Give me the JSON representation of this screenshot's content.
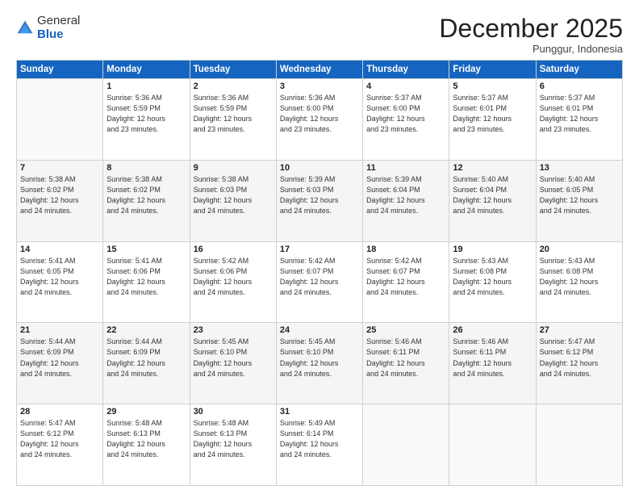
{
  "logo": {
    "general": "General",
    "blue": "Blue"
  },
  "header": {
    "month": "December 2025",
    "location": "Punggur, Indonesia"
  },
  "weekdays": [
    "Sunday",
    "Monday",
    "Tuesday",
    "Wednesday",
    "Thursday",
    "Friday",
    "Saturday"
  ],
  "weeks": [
    [
      {
        "day": "",
        "info": ""
      },
      {
        "day": "1",
        "info": "Sunrise: 5:36 AM\nSunset: 5:59 PM\nDaylight: 12 hours\nand 23 minutes."
      },
      {
        "day": "2",
        "info": "Sunrise: 5:36 AM\nSunset: 5:59 PM\nDaylight: 12 hours\nand 23 minutes."
      },
      {
        "day": "3",
        "info": "Sunrise: 5:36 AM\nSunset: 6:00 PM\nDaylight: 12 hours\nand 23 minutes."
      },
      {
        "day": "4",
        "info": "Sunrise: 5:37 AM\nSunset: 6:00 PM\nDaylight: 12 hours\nand 23 minutes."
      },
      {
        "day": "5",
        "info": "Sunrise: 5:37 AM\nSunset: 6:01 PM\nDaylight: 12 hours\nand 23 minutes."
      },
      {
        "day": "6",
        "info": "Sunrise: 5:37 AM\nSunset: 6:01 PM\nDaylight: 12 hours\nand 23 minutes."
      }
    ],
    [
      {
        "day": "7",
        "info": "Sunrise: 5:38 AM\nSunset: 6:02 PM\nDaylight: 12 hours\nand 24 minutes."
      },
      {
        "day": "8",
        "info": "Sunrise: 5:38 AM\nSunset: 6:02 PM\nDaylight: 12 hours\nand 24 minutes."
      },
      {
        "day": "9",
        "info": "Sunrise: 5:38 AM\nSunset: 6:03 PM\nDaylight: 12 hours\nand 24 minutes."
      },
      {
        "day": "10",
        "info": "Sunrise: 5:39 AM\nSunset: 6:03 PM\nDaylight: 12 hours\nand 24 minutes."
      },
      {
        "day": "11",
        "info": "Sunrise: 5:39 AM\nSunset: 6:04 PM\nDaylight: 12 hours\nand 24 minutes."
      },
      {
        "day": "12",
        "info": "Sunrise: 5:40 AM\nSunset: 6:04 PM\nDaylight: 12 hours\nand 24 minutes."
      },
      {
        "day": "13",
        "info": "Sunrise: 5:40 AM\nSunset: 6:05 PM\nDaylight: 12 hours\nand 24 minutes."
      }
    ],
    [
      {
        "day": "14",
        "info": "Sunrise: 5:41 AM\nSunset: 6:05 PM\nDaylight: 12 hours\nand 24 minutes."
      },
      {
        "day": "15",
        "info": "Sunrise: 5:41 AM\nSunset: 6:06 PM\nDaylight: 12 hours\nand 24 minutes."
      },
      {
        "day": "16",
        "info": "Sunrise: 5:42 AM\nSunset: 6:06 PM\nDaylight: 12 hours\nand 24 minutes."
      },
      {
        "day": "17",
        "info": "Sunrise: 5:42 AM\nSunset: 6:07 PM\nDaylight: 12 hours\nand 24 minutes."
      },
      {
        "day": "18",
        "info": "Sunrise: 5:42 AM\nSunset: 6:07 PM\nDaylight: 12 hours\nand 24 minutes."
      },
      {
        "day": "19",
        "info": "Sunrise: 5:43 AM\nSunset: 6:08 PM\nDaylight: 12 hours\nand 24 minutes."
      },
      {
        "day": "20",
        "info": "Sunrise: 5:43 AM\nSunset: 6:08 PM\nDaylight: 12 hours\nand 24 minutes."
      }
    ],
    [
      {
        "day": "21",
        "info": "Sunrise: 5:44 AM\nSunset: 6:09 PM\nDaylight: 12 hours\nand 24 minutes."
      },
      {
        "day": "22",
        "info": "Sunrise: 5:44 AM\nSunset: 6:09 PM\nDaylight: 12 hours\nand 24 minutes."
      },
      {
        "day": "23",
        "info": "Sunrise: 5:45 AM\nSunset: 6:10 PM\nDaylight: 12 hours\nand 24 minutes."
      },
      {
        "day": "24",
        "info": "Sunrise: 5:45 AM\nSunset: 6:10 PM\nDaylight: 12 hours\nand 24 minutes."
      },
      {
        "day": "25",
        "info": "Sunrise: 5:46 AM\nSunset: 6:11 PM\nDaylight: 12 hours\nand 24 minutes."
      },
      {
        "day": "26",
        "info": "Sunrise: 5:46 AM\nSunset: 6:11 PM\nDaylight: 12 hours\nand 24 minutes."
      },
      {
        "day": "27",
        "info": "Sunrise: 5:47 AM\nSunset: 6:12 PM\nDaylight: 12 hours\nand 24 minutes."
      }
    ],
    [
      {
        "day": "28",
        "info": "Sunrise: 5:47 AM\nSunset: 6:12 PM\nDaylight: 12 hours\nand 24 minutes."
      },
      {
        "day": "29",
        "info": "Sunrise: 5:48 AM\nSunset: 6:13 PM\nDaylight: 12 hours\nand 24 minutes."
      },
      {
        "day": "30",
        "info": "Sunrise: 5:48 AM\nSunset: 6:13 PM\nDaylight: 12 hours\nand 24 minutes."
      },
      {
        "day": "31",
        "info": "Sunrise: 5:49 AM\nSunset: 6:14 PM\nDaylight: 12 hours\nand 24 minutes."
      },
      {
        "day": "",
        "info": ""
      },
      {
        "day": "",
        "info": ""
      },
      {
        "day": "",
        "info": ""
      }
    ]
  ]
}
